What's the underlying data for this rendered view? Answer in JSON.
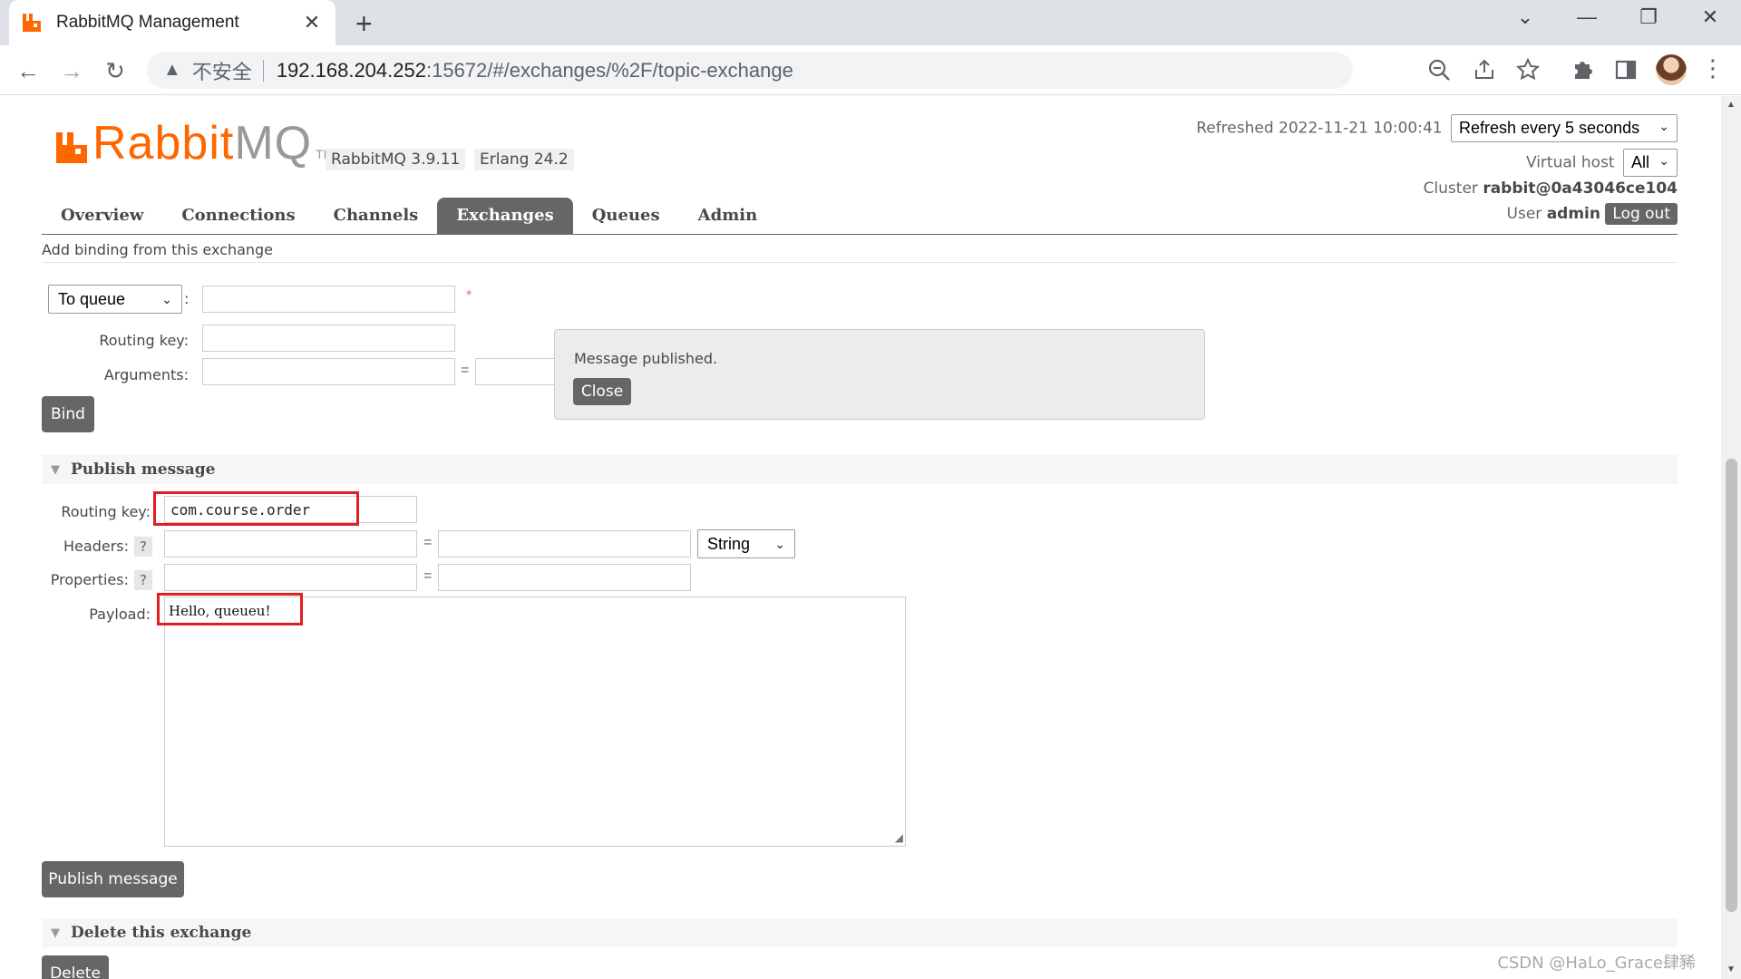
{
  "browser": {
    "tab_title": "RabbitMQ Management",
    "tab_close": "✕",
    "new_tab": "+",
    "window_controls": [
      "⌄",
      "—",
      "❐",
      "✕"
    ],
    "nav": {
      "back": "←",
      "forward": "→",
      "reload": "↻"
    },
    "security_warning": "不安全",
    "url_host": "192.168.204.252",
    "url_path": ":15672/#/exchanges/%2F/topic-exchange",
    "icons": [
      "zoom-icon",
      "share-icon",
      "star-icon",
      "extensions-icon",
      "sidepanel-icon",
      "profile-avatar",
      "menu-icon"
    ]
  },
  "header": {
    "logo_rabbit": "Rabbit",
    "logo_mq": "MQ",
    "logo_tm": "TM",
    "version": "RabbitMQ 3.9.11",
    "erlang": "Erlang 24.2",
    "refreshed": "Refreshed 2022-11-21 10:00:41",
    "refresh_select": "Refresh every 5 seconds",
    "vhost_label": "Virtual host",
    "vhost_select": "All",
    "cluster_label": "Cluster",
    "cluster_name": "rabbit@0a43046ce104",
    "user_label": "User",
    "user_name": "admin",
    "logout": "Log out"
  },
  "tabs": [
    {
      "label": "Overview"
    },
    {
      "label": "Connections"
    },
    {
      "label": "Channels"
    },
    {
      "label": "Exchanges",
      "active": true
    },
    {
      "label": "Queues"
    },
    {
      "label": "Admin"
    }
  ],
  "binding": {
    "subtitle": "Add binding from this exchange",
    "destination_type": "To queue",
    "destination_colon": ":",
    "required_mark": "*",
    "routing_key_label": "Routing key:",
    "arguments_label": "Arguments:",
    "equals": "=",
    "bind_button": "Bind"
  },
  "popup": {
    "message": "Message published.",
    "close": "Close"
  },
  "publish": {
    "section_title": "Publish message",
    "routing_key_label": "Routing key:",
    "routing_key_value": "com.course.order",
    "headers_label": "Headers:",
    "help": "?",
    "headers_type": "String",
    "properties_label": "Properties:",
    "payload_label": "Payload:",
    "payload_value": "Hello, queueu!",
    "publish_button": "Publish message"
  },
  "delete": {
    "section_title": "Delete this exchange",
    "delete_button": "Delete"
  },
  "watermark": "CSDN @HaLo_Grace肆豨",
  "colors": {
    "accent": "#ff6600",
    "tab_active": "#666666",
    "highlight": "#e02020"
  }
}
